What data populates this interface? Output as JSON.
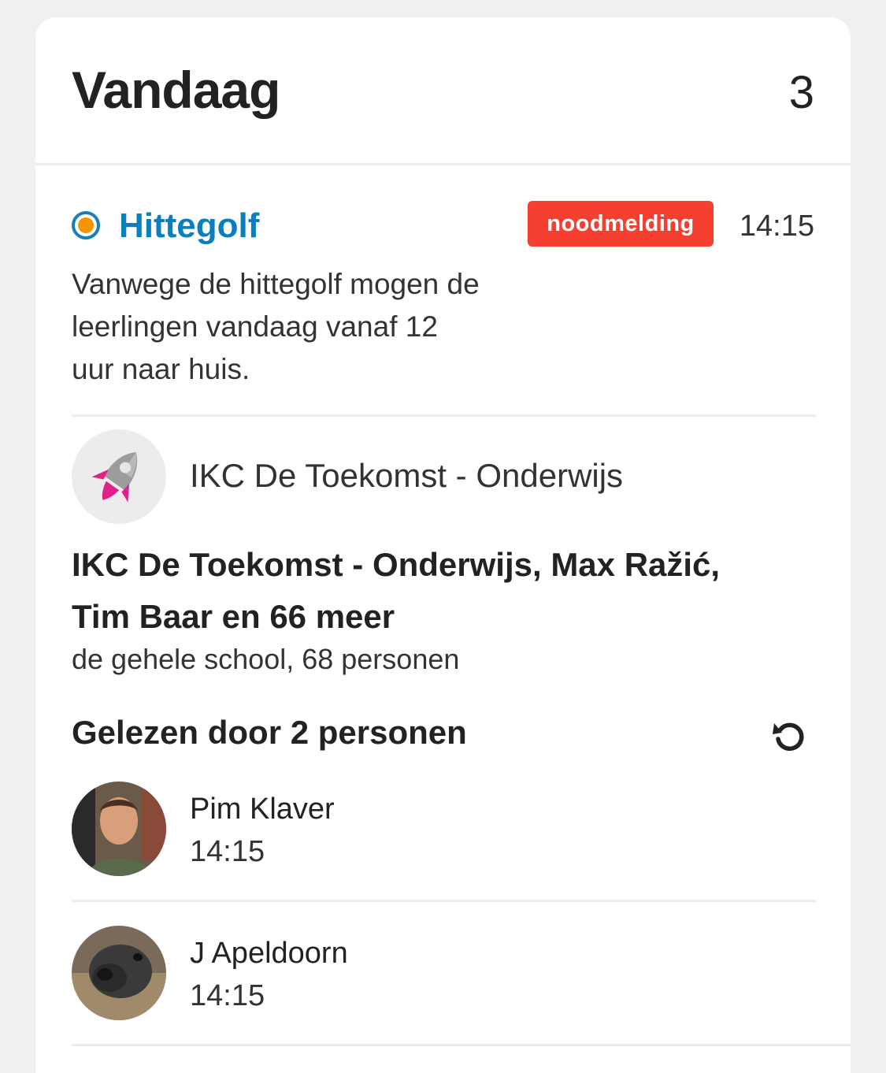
{
  "section": {
    "title": "Vandaag",
    "count": "3"
  },
  "message": {
    "title": "Hittegolf",
    "badge": "noodmelding",
    "time": "14:15",
    "body_lines": [
      "Vanwege de hittegolf mogen de",
      "leerlingen vandaag vanaf 12",
      "uur naar huis."
    ],
    "status_dot_color": "#f29500",
    "title_color": "#0a7fbf",
    "badge_color": "#f53f30"
  },
  "sender": {
    "name": "IKC De Toekomst - Onderwijs",
    "avatar_icon": "rocket-icon"
  },
  "recipients": {
    "line1": "IKC De Toekomst - Onderwijs, Max Ražić,",
    "line2": "Tim Baar en 66 meer",
    "summary": "de gehele school, 68 personen"
  },
  "read_receipts": {
    "label": "Gelezen door 2 personen",
    "refresh_icon": "refresh-icon",
    "readers": [
      {
        "name": "Pim Klaver",
        "time": "14:15"
      },
      {
        "name": "J Apeldoorn",
        "time": "14:15"
      }
    ]
  }
}
